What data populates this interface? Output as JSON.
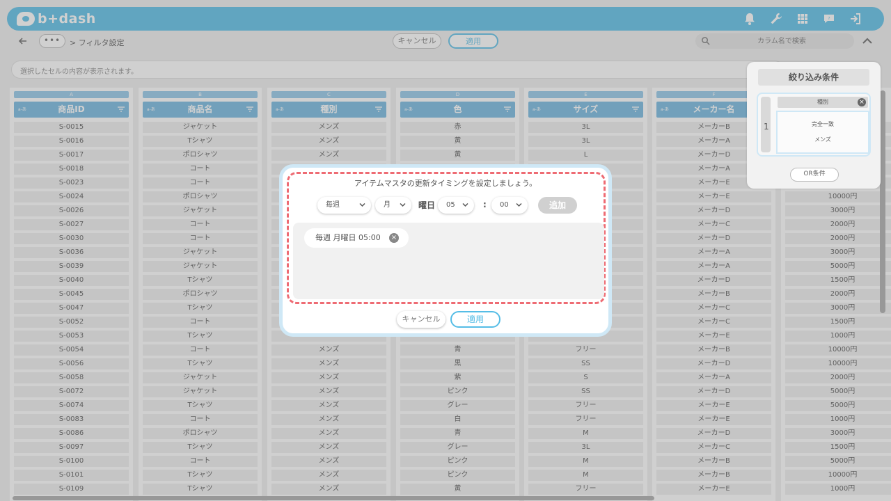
{
  "app": {
    "logo_text": "b+dash",
    "accent_color": "#55bde6",
    "header_icons": [
      "bell-icon",
      "wrench-icon",
      "grid-icon",
      "chat-icon",
      "logout-icon"
    ]
  },
  "toolbar": {
    "dots": "•••",
    "breadcrumb": "> フィルタ設定",
    "cancel_label": "キャンセル",
    "apply_label": "適用",
    "search_placeholder": "カラム名で検索"
  },
  "cell_bar": {
    "placeholder": "選択したセルの内容が表示されます。"
  },
  "grid": {
    "columns": [
      {
        "letter": "A",
        "name": "商品ID"
      },
      {
        "letter": "B",
        "name": "商品名"
      },
      {
        "letter": "C",
        "name": "種別"
      },
      {
        "letter": "D",
        "name": "色"
      },
      {
        "letter": "E",
        "name": "サイズ"
      },
      {
        "letter": "F",
        "name": "メーカー名"
      }
    ],
    "sort_icon_text": "a-あ",
    "rows": [
      [
        "S-0015",
        "ジャケット",
        "メンズ",
        "赤",
        "3L",
        "メーカーB",
        ""
      ],
      [
        "S-0016",
        "Tシャツ",
        "メンズ",
        "黄",
        "3L",
        "メーカーA",
        ""
      ],
      [
        "S-0017",
        "ポロシャツ",
        "メンズ",
        "黄",
        "L",
        "メーカーD",
        ""
      ],
      [
        "S-0018",
        "コート",
        "",
        "",
        "",
        "メーカーA",
        ""
      ],
      [
        "S-0023",
        "コート",
        "",
        "",
        "",
        "メーカーE",
        ""
      ],
      [
        "S-0024",
        "ポロシャツ",
        "",
        "",
        "",
        "メーカーE",
        "10000円"
      ],
      [
        "S-0026",
        "ジャケット",
        "",
        "",
        "",
        "メーカーD",
        "3000円"
      ],
      [
        "S-0027",
        "コート",
        "",
        "",
        "",
        "メーカーC",
        "2000円"
      ],
      [
        "S-0030",
        "コート",
        "",
        "",
        "",
        "メーカーD",
        "2000円"
      ],
      [
        "S-0036",
        "ジャケット",
        "",
        "",
        "",
        "メーカーA",
        "3000円"
      ],
      [
        "S-0039",
        "ジャケット",
        "",
        "",
        "",
        "メーカーA",
        "5000円"
      ],
      [
        "S-0040",
        "Tシャツ",
        "",
        "",
        "",
        "メーカーD",
        "1500円"
      ],
      [
        "S-0045",
        "ポロシャツ",
        "",
        "",
        "",
        "メーカーB",
        "2000円"
      ],
      [
        "S-0047",
        "Tシャツ",
        "",
        "",
        "",
        "メーカーC",
        "3000円"
      ],
      [
        "S-0052",
        "コート",
        "",
        "",
        "",
        "メーカーC",
        "1500円"
      ],
      [
        "S-0053",
        "Tシャツ",
        "",
        "",
        "",
        "メーカーE",
        "1000円"
      ],
      [
        "S-0054",
        "コート",
        "メンズ",
        "青",
        "フリー",
        "メーカーB",
        "10000円"
      ],
      [
        "S-0056",
        "Tシャツ",
        "メンズ",
        "黒",
        "SS",
        "メーカーD",
        "10000円"
      ],
      [
        "S-0058",
        "ジャケット",
        "メンズ",
        "紫",
        "S",
        "メーカーA",
        "2000円"
      ],
      [
        "S-0072",
        "ジャケット",
        "メンズ",
        "ピンク",
        "SS",
        "メーカーD",
        "5000円"
      ],
      [
        "S-0074",
        "Tシャツ",
        "メンズ",
        "グレー",
        "フリー",
        "メーカーE",
        "5000円"
      ],
      [
        "S-0083",
        "コート",
        "メンズ",
        "白",
        "フリー",
        "メーカーE",
        "1000円"
      ],
      [
        "S-0086",
        "ポロシャツ",
        "メンズ",
        "青",
        "M",
        "メーカーD",
        "3000円"
      ],
      [
        "S-0097",
        "Tシャツ",
        "メンズ",
        "グレー",
        "3L",
        "メーカーC",
        "1500円"
      ],
      [
        "S-0100",
        "コート",
        "メンズ",
        "ピンク",
        "M",
        "メーカーB",
        "5000円"
      ],
      [
        "S-0101",
        "Tシャツ",
        "メンズ",
        "ピンク",
        "M",
        "メーカーB",
        "10000円"
      ],
      [
        "S-0109",
        "Tシャツ",
        "メンズ",
        "黄",
        "フリー",
        "メーカーE",
        "1000円"
      ]
    ]
  },
  "filter_panel": {
    "title": "絞り込み条件",
    "group_number": "1",
    "field_chip": "種別",
    "condition_type": "完全一致",
    "condition_value": "メンズ",
    "or_button": "OR条件"
  },
  "modal": {
    "title": "アイテムマスタの更新タイミングを設定しましょう。",
    "frequency": "毎週",
    "weekday": "月",
    "weekday_label": "曜日",
    "hour": "05",
    "minute": "00",
    "colon": ":",
    "add_label": "追加",
    "schedule_item": "毎週 月曜日 05:00",
    "close_glyph": "×",
    "cancel_label": "キャンセル",
    "apply_label": "適用",
    "highlight_color": "#ee6b73"
  }
}
